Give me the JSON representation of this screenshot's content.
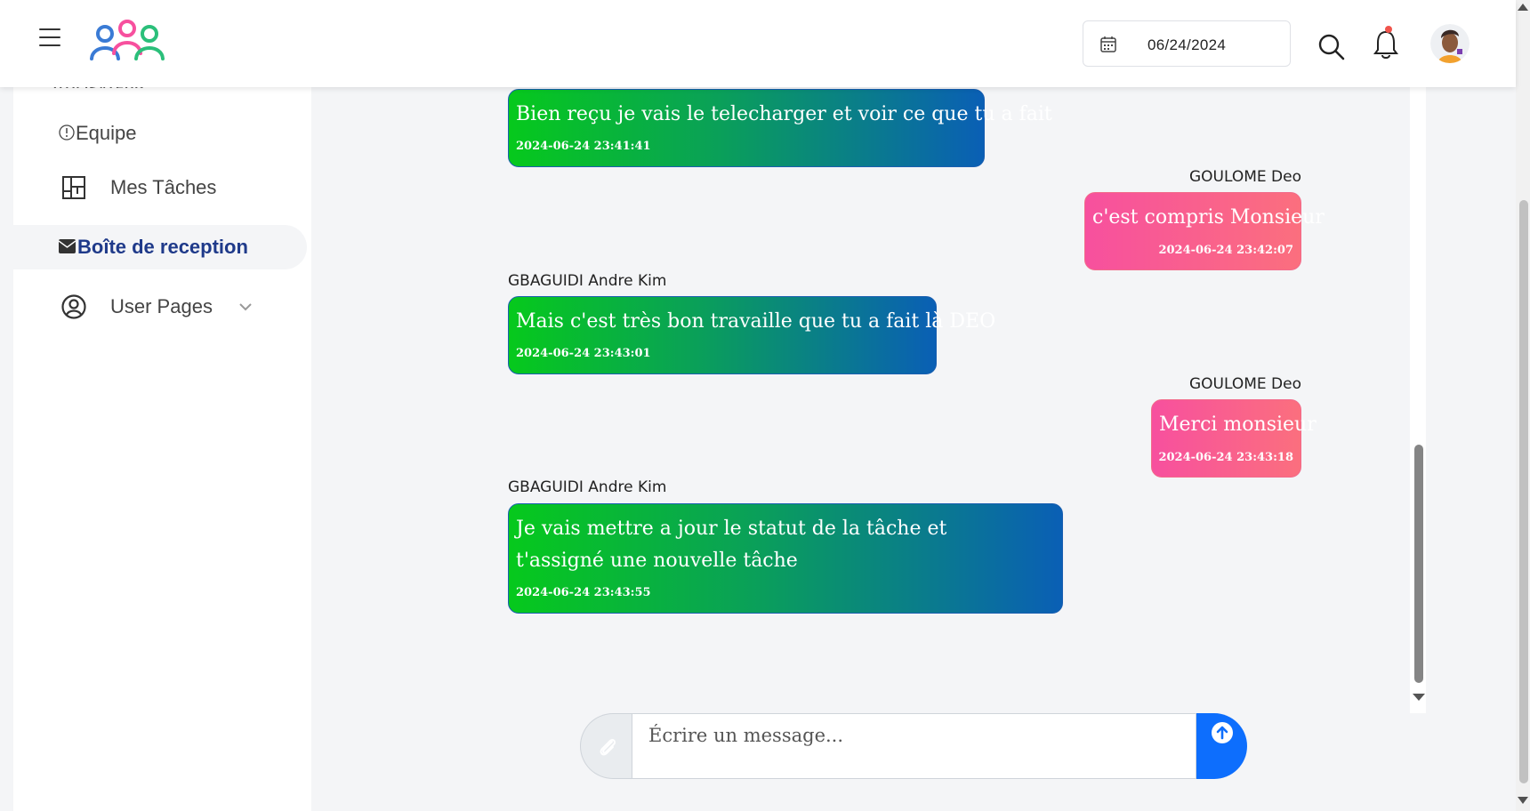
{
  "header": {
    "date_value": "06/24/2024",
    "brand_colors": [
      "#3a7bd5",
      "#f7509e",
      "#2bbf7a"
    ]
  },
  "sidebar": {
    "section_label": "UTILISATEUR",
    "items": [
      {
        "label": "Equipe",
        "icon": "info-circle-icon",
        "active": false
      },
      {
        "label": "Mes Tâches",
        "icon": "layout-board-icon",
        "active": false
      },
      {
        "label": "Boîte de reception",
        "icon": "envelope-icon",
        "active": true
      },
      {
        "label": "User Pages",
        "icon": "user-circle-icon",
        "active": false
      }
    ]
  },
  "chat": {
    "messages": [
      {
        "direction": "in",
        "sender": "",
        "text": "Bien reçu je vais le telecharger et voir ce que tu a fait",
        "time": "2024-06-24 23:41:41"
      },
      {
        "direction": "out",
        "sender": "GOULOME Deo",
        "text": "c'est compris Monsieur",
        "time": "2024-06-24 23:42:07"
      },
      {
        "direction": "in",
        "sender": "GBAGUIDI Andre Kim",
        "text": "Mais c'est très bon travaille que tu a fait là DEO",
        "time": "2024-06-24 23:43:01"
      },
      {
        "direction": "out",
        "sender": "GOULOME Deo",
        "text": "Merci monsieur",
        "time": "2024-06-24 23:43:18"
      },
      {
        "direction": "in",
        "sender": "GBAGUIDI Andre Kim",
        "text": "Je vais mettre a jour le statut de la tâche et t'assigné une nouvelle tâche",
        "time": "2024-06-24 23:43:55"
      }
    ]
  },
  "composer": {
    "placeholder": "Écrire un message...",
    "accent_color": "#0d6efd"
  }
}
